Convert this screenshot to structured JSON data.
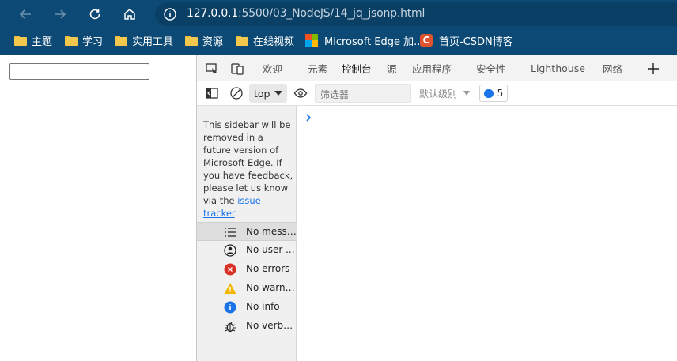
{
  "browser": {
    "url_host": "127.0.0.1",
    "url_rest": ":5500/03_NodeJS/14_jq_jsonp.html",
    "bookmarks": [
      {
        "label": "主题",
        "icon": "folder-icon"
      },
      {
        "label": "学习",
        "icon": "folder-icon"
      },
      {
        "label": "实用工具",
        "icon": "folder-icon"
      },
      {
        "label": "资源",
        "icon": "folder-icon"
      },
      {
        "label": "在线视频",
        "icon": "folder-icon"
      },
      {
        "label": "Microsoft Edge 加...",
        "icon": "microsoft-logo-icon"
      },
      {
        "label": "首页-CSDN博客",
        "icon": "csdn-logo-icon"
      }
    ]
  },
  "devtools": {
    "tabs": [
      "欢迎",
      "元素",
      "控制台",
      "源",
      "应用程序",
      "安全性",
      "Lighthouse",
      "网络"
    ],
    "active_tab": "控制台",
    "context": "top",
    "filter_placeholder": "筛选器",
    "level_label": "默认级别",
    "issues_count": "5",
    "sidebar": {
      "notice_text": "This sidebar will be removed in a future version of Microsoft Edge. If you have feedback, please let us know via the",
      "notice_link": "issue tracker",
      "notice_end": ".",
      "items": [
        {
          "label": "No messa...",
          "icon": "list-icon"
        },
        {
          "label": "No user ...",
          "icon": "user-icon"
        },
        {
          "label": "No errors",
          "icon": "error-icon"
        },
        {
          "label": "No warni...",
          "icon": "warning-icon"
        },
        {
          "label": "No info",
          "icon": "info-icon"
        },
        {
          "label": "No verbose",
          "icon": "bug-icon"
        }
      ]
    },
    "colors": {
      "accent": "#1a73e8",
      "titlebar": "#0c4a75",
      "error": "#d93025",
      "warning": "#f2b600"
    }
  }
}
